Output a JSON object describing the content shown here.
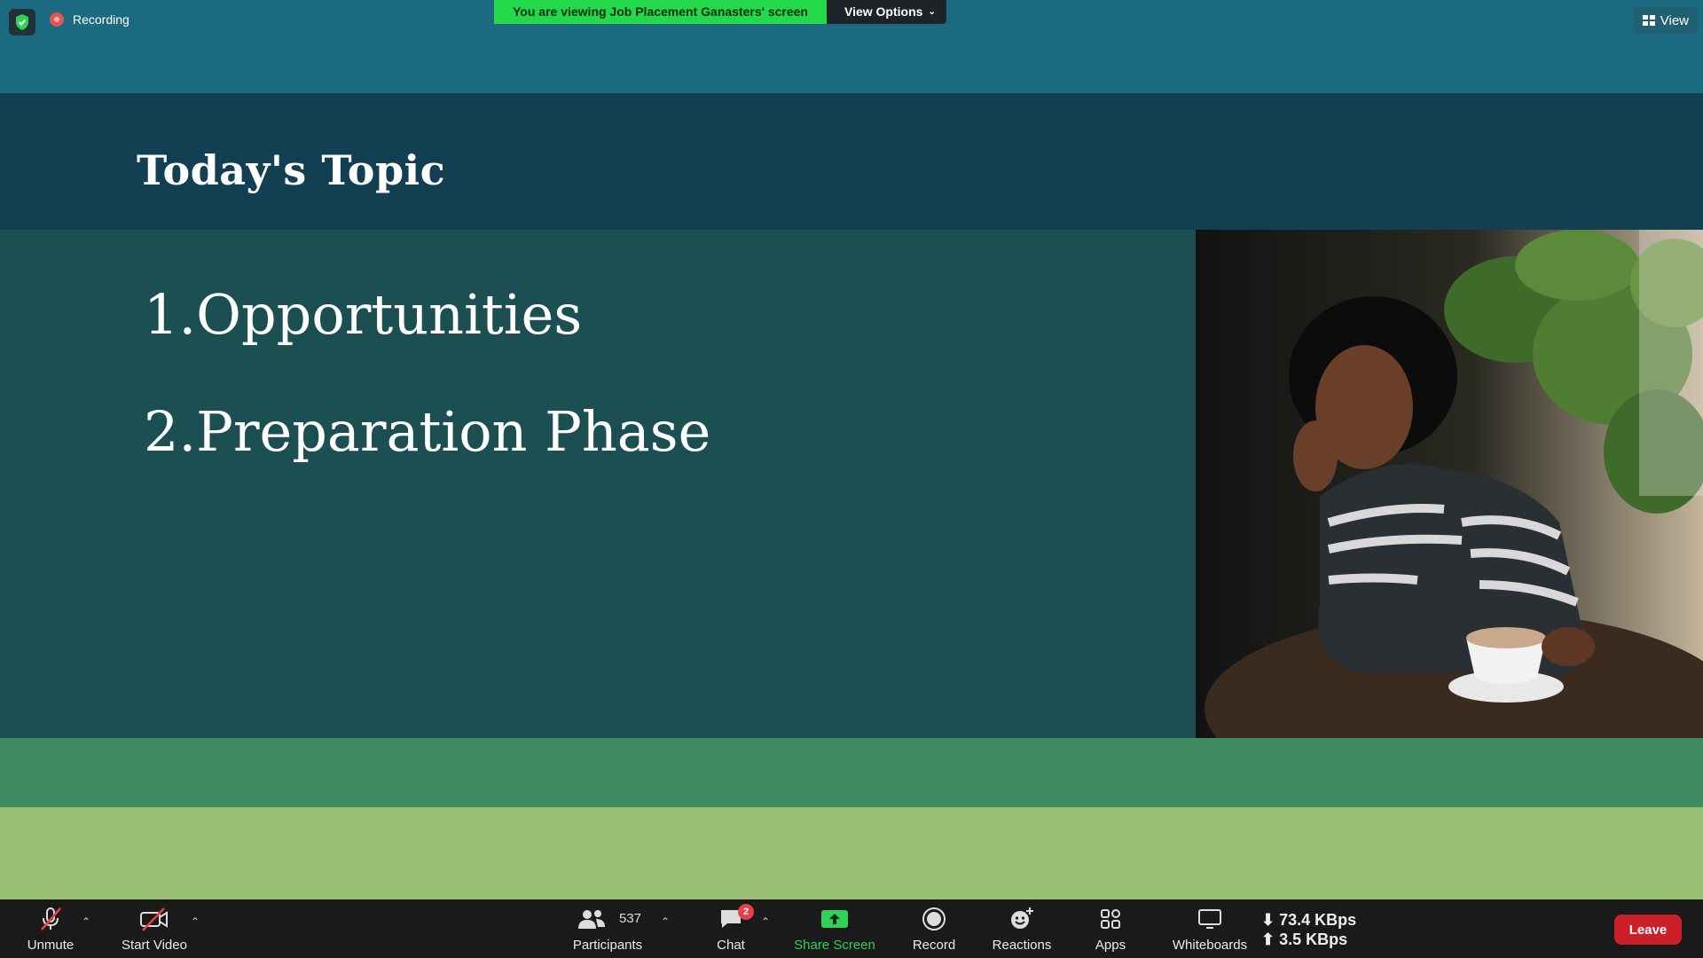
{
  "top": {
    "recording_label": "Recording",
    "banner_message": "You are viewing Job Placement Ganasters' screen",
    "view_options_label": "View Options",
    "view_label": "View"
  },
  "slide": {
    "title": "Today's Topic",
    "items": [
      "1.Opportunities",
      "2.Preparation Phase"
    ]
  },
  "toolbar": {
    "unmute": "Unmute",
    "start_video": "Start Video",
    "participants_label": "Participants",
    "participants_count": "537",
    "chat_label": "Chat",
    "chat_badge": "2",
    "share_screen": "Share Screen",
    "record": "Record",
    "reactions": "Reactions",
    "apps": "Apps",
    "whiteboards": "Whiteboards",
    "download_rate": "73.4 KBps",
    "upload_rate": "3.5 KBps",
    "leave": "Leave"
  },
  "colors": {
    "accent_green": "#23d94a",
    "leave_red": "#cc1f2a",
    "slide_head": "#123f52",
    "slide_body": "#1b4f52"
  }
}
